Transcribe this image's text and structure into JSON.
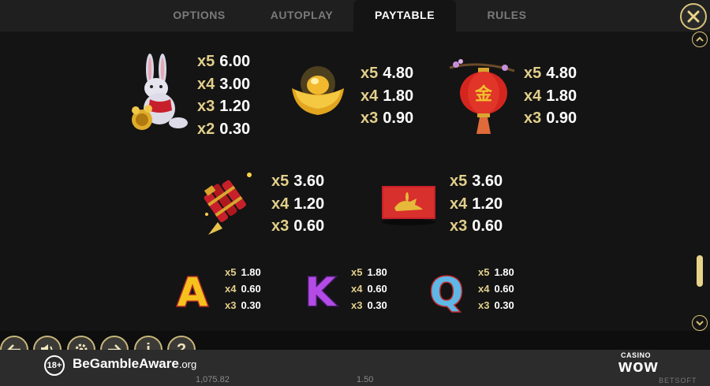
{
  "tabs": {
    "options": "OPTIONS",
    "autoplay": "AUTOPLAY",
    "paytable": "PAYTABLE",
    "rules": "RULES"
  },
  "symbols": {
    "rabbit": {
      "rows": [
        {
          "mult": "x5",
          "val": "6.00"
        },
        {
          "mult": "x4",
          "val": "3.00"
        },
        {
          "mult": "x3",
          "val": "1.20"
        },
        {
          "mult": "x2",
          "val": "0.30"
        }
      ]
    },
    "ingot": {
      "rows": [
        {
          "mult": "x5",
          "val": "4.80"
        },
        {
          "mult": "x4",
          "val": "1.80"
        },
        {
          "mult": "x3",
          "val": "0.90"
        }
      ]
    },
    "lantern": {
      "glyph": "金",
      "rows": [
        {
          "mult": "x5",
          "val": "4.80"
        },
        {
          "mult": "x4",
          "val": "1.80"
        },
        {
          "mult": "x3",
          "val": "0.90"
        }
      ]
    },
    "firecrackers": {
      "rows": [
        {
          "mult": "x5",
          "val": "3.60"
        },
        {
          "mult": "x4",
          "val": "1.20"
        },
        {
          "mult": "x3",
          "val": "0.60"
        }
      ]
    },
    "envelope": {
      "rows": [
        {
          "mult": "x5",
          "val": "3.60"
        },
        {
          "mult": "x4",
          "val": "1.20"
        },
        {
          "mult": "x3",
          "val": "0.60"
        }
      ]
    },
    "letter_a": {
      "letter": "A",
      "rows": [
        {
          "mult": "x5",
          "val": "1.80"
        },
        {
          "mult": "x4",
          "val": "0.60"
        },
        {
          "mult": "x3",
          "val": "0.30"
        }
      ]
    },
    "letter_k": {
      "letter": "K",
      "rows": [
        {
          "mult": "x5",
          "val": "1.80"
        },
        {
          "mult": "x4",
          "val": "0.60"
        },
        {
          "mult": "x3",
          "val": "0.30"
        }
      ]
    },
    "letter_q": {
      "letter": "Q",
      "rows": [
        {
          "mult": "x5",
          "val": "1.80"
        },
        {
          "mult": "x4",
          "val": "0.60"
        },
        {
          "mult": "x3",
          "val": "0.30"
        }
      ]
    }
  },
  "controls": {
    "icons": [
      "back-arrow-icon",
      "sound-icon",
      "settings-gear-icon",
      "forward-arrow-icon",
      "info-icon",
      "help-icon"
    ],
    "info_label": "i",
    "help_label": "?"
  },
  "footer": {
    "age": "18+",
    "be": "Be",
    "gamble": "Gamble",
    "aware": "Aware",
    "org": ".org",
    "casino": "CASINO",
    "wow": "wow",
    "balance": "1,075.82",
    "bet": "1.50",
    "provider": "BETSOFT"
  },
  "colors": {
    "accent_gold": "#e2cf8b",
    "background": "#141414",
    "tab_bar": "#1f1f1f"
  }
}
